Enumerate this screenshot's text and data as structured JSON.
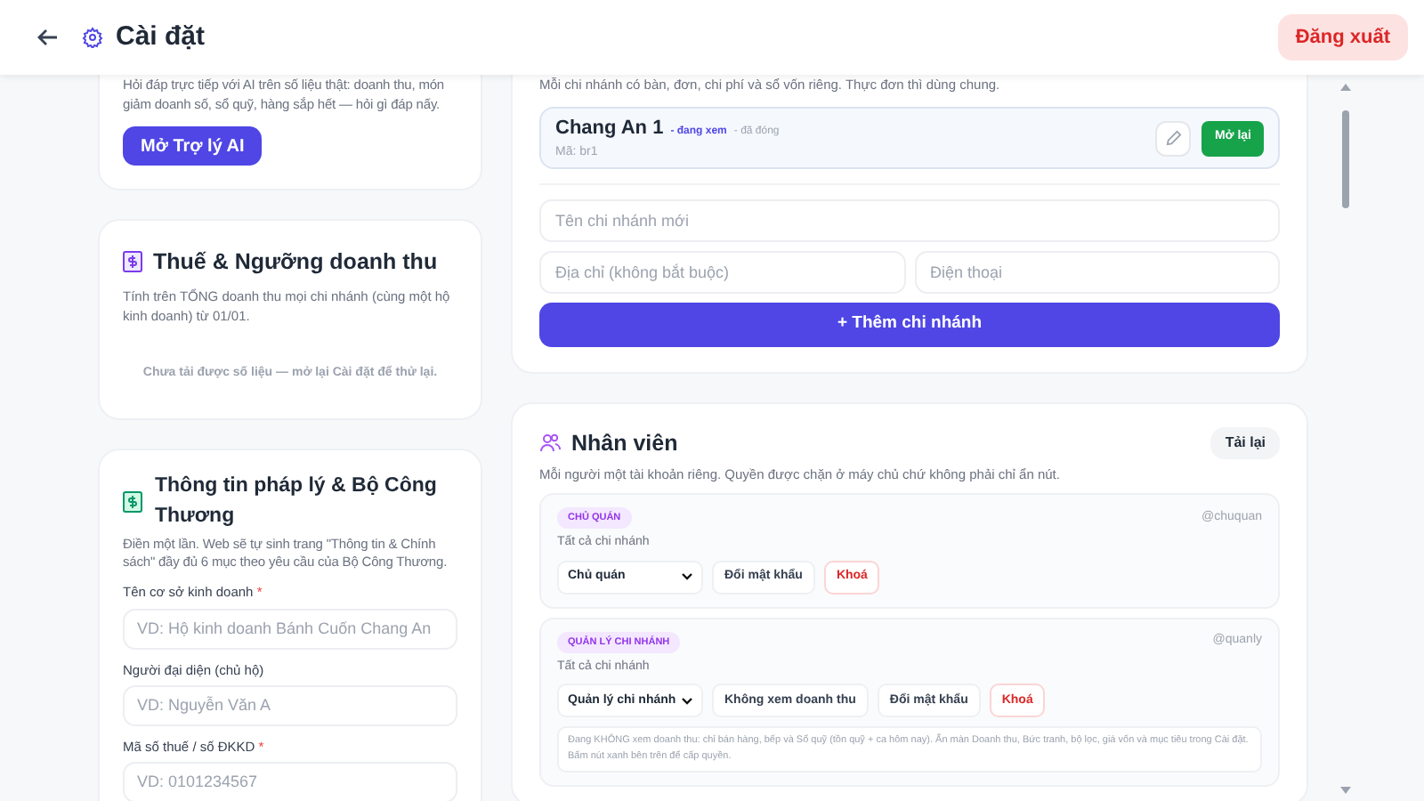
{
  "header": {
    "title": "Cài đặt",
    "logout": "Đăng xuất"
  },
  "ai_card": {
    "description": "Hỏi đáp trực tiếp với AI trên số liệu thật: doanh thu, món giảm doanh số, sổ quỹ, hàng sắp hết — hỏi gì đáp nấy.",
    "button": "Mở Trợ lý AI"
  },
  "tax_card": {
    "title": "Thuế & Ngưỡng doanh thu",
    "description": "Tính trên TỔNG doanh thu mọi chi nhánh (cùng một hộ kinh doanh) từ 01/01.",
    "status": "Chưa tải được số liệu — mở lại Cài đặt để thử lại."
  },
  "legal_card": {
    "title": "Thông tin pháp lý & Bộ Công Thương",
    "description": "Điền một lần. Web sẽ tự sinh trang \"Thông tin & Chính sách\" đầy đủ 6 mục theo yêu cầu của Bộ Công Thương.",
    "fields": [
      {
        "label": "Tên cơ sở kinh doanh",
        "mark": "*",
        "placeholder": "VD: Hộ kinh doanh Bánh Cuốn Chang An"
      },
      {
        "label": "Người đại diện (chủ hộ)",
        "placeholder": "VD: Nguyễn Văn A"
      },
      {
        "label": "Mã số thuế / số ĐKKD",
        "mark": "*",
        "placeholder": "VD: 0101234567"
      }
    ]
  },
  "branches_card": {
    "description": "Mỗi chi nhánh có bàn, đơn, chi phí và sổ vốn riêng. Thực đơn thì dùng chung.",
    "branches": [
      {
        "name": "Chang An 1",
        "tags": [
          {
            "text": "- đang xem",
            "kind": "viewing"
          },
          {
            "text": "- đã đóng",
            "kind": "closed"
          }
        ],
        "code": "Mã: br1",
        "action": "Mở lại"
      }
    ],
    "name_placeholder": "Tên chi nhánh mới",
    "address_placeholder": "Địa chỉ (không bắt buộc)",
    "phone_placeholder": "Điện thoại",
    "add_button": "+ Thêm chi nhánh"
  },
  "staff_card": {
    "title": "Nhân viên",
    "reload": "Tải lại",
    "description": "Mỗi người một tài khoản riêng. Quyền được chặn ở máy chủ chứ không phải chỉ ẩn nút.",
    "members": [
      {
        "role": "CHỦ QUÁN",
        "username": "@chuquan",
        "scope": "Tất cả chi nhánh",
        "role_select": "Chủ quán",
        "buttons": [
          {
            "label": "Đổi mật khẩu",
            "kind": "neutral"
          },
          {
            "label": "Khoá",
            "kind": "danger"
          }
        ]
      },
      {
        "role": "QUẢN LÝ CHI NHÁNH",
        "username": "@quanly",
        "scope": "Tất cả chi nhánh",
        "role_select": "Quản lý chi nhánh",
        "buttons": [
          {
            "label": "Không xem doanh thu",
            "kind": "neutral"
          },
          {
            "label": "Đổi mật khẩu",
            "kind": "neutral"
          },
          {
            "label": "Khoá",
            "kind": "danger"
          }
        ],
        "note": "Đang KHÔNG xem doanh thu: chỉ bán hàng, bếp và Sổ quỹ (tồn quỹ + ca hôm nay). Ẩn màn Doanh thu, Bức tranh, bộ lọc, giá vốn và mục tiêu trong Cài đặt. Bấm nút xanh bên trên để cấp quyền."
      }
    ]
  }
}
